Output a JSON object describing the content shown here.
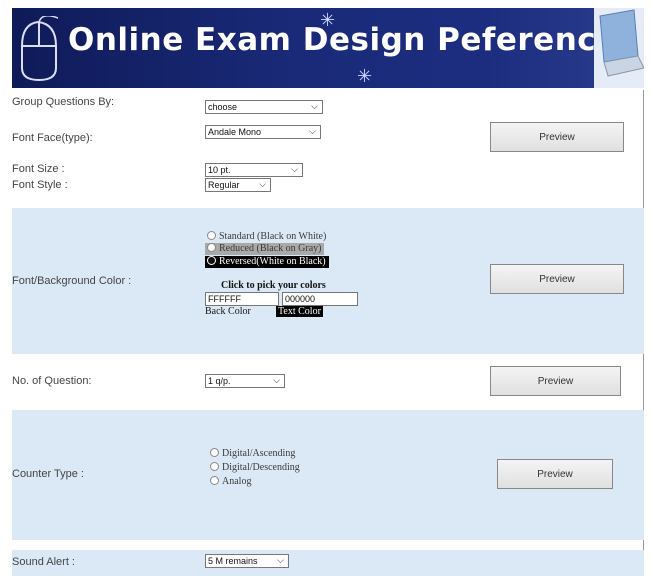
{
  "header": {
    "title": "Online Exam Design Peferences"
  },
  "group_questions": {
    "label": "Group Questions By:",
    "value": "choose"
  },
  "font_face": {
    "label": "Font Face(type):",
    "value": "Andale Mono",
    "preview": "Preview"
  },
  "font_size": {
    "label": "Font Size :",
    "value": "10 pt."
  },
  "font_style": {
    "label": "Font Style :",
    "value": "Regular"
  },
  "color": {
    "label": "Font/Background Color :",
    "options": [
      "Standard (Black on White)",
      "Reduced (Black on Gray)",
      "Reversed(White on Black)"
    ],
    "selected": "Reversed(White on Black)",
    "pick_heading": "Click to pick your colors",
    "back_value": "FFFFFF",
    "text_value": "000000",
    "back_label": "Back Color",
    "text_label": "Text Color",
    "preview": "Preview"
  },
  "questions": {
    "label": "No. of Question:",
    "value": "1 q/p.",
    "preview": "Preview"
  },
  "counter": {
    "label": "Counter Type :",
    "options": [
      "Digital/Ascending",
      "Digital/Descending",
      "Analog"
    ],
    "preview": "Preview"
  },
  "sound": {
    "label": "Sound Alert :",
    "value": "5 M remains"
  },
  "colors": {
    "banner": "#1a2a78",
    "section_bg": "#dbe9f6"
  }
}
